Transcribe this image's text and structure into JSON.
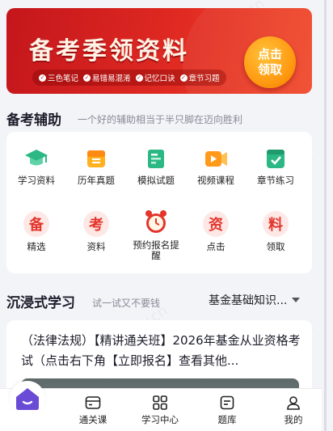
{
  "banner": {
    "title": "备考季领资料",
    "tags": [
      "三色笔记",
      "易错易混淆",
      "记忆口诀",
      "章节习题"
    ],
    "claim_button": "点击领取",
    "colors": {
      "bg": "#d81e1e",
      "button": "#ff9b12"
    }
  },
  "section_support": {
    "title": "备考辅助",
    "subtitle": "一个好的辅助相当于半只脚在迈向胜利"
  },
  "grid": [
    {
      "label": "学习资料",
      "icon": "graduation-cap-icon"
    },
    {
      "label": "历年真题",
      "icon": "gift-box-icon"
    },
    {
      "label": "模拟试题",
      "icon": "test-paper-icon"
    },
    {
      "label": "视频课程",
      "icon": "video-play-icon"
    },
    {
      "label": "章节练习",
      "icon": "checklist-icon"
    },
    {
      "label": "精选",
      "icon": "char-bei-icon",
      "char": "备"
    },
    {
      "label": "资料",
      "icon": "char-kao-icon",
      "char": "考"
    },
    {
      "label": "预约报名提醒",
      "icon": "alarm-clock-icon"
    },
    {
      "label": "点击",
      "icon": "char-zi-icon",
      "char": "资"
    },
    {
      "label": "领取",
      "icon": "char-liao-icon",
      "char": "料"
    }
  ],
  "section_immersive": {
    "title": "沉浸式学习",
    "subtitle": "试一试又不要钱",
    "dropdown_value": "基金基础知识..."
  },
  "course": {
    "text": "（法律法规）【精讲通关班】2026年基金从业资格考试（点击右下角【立即报名】查看其他..."
  },
  "bottom_nav": [
    {
      "label": "",
      "icon": "home-icon"
    },
    {
      "label": "通关课",
      "icon": "card-icon"
    },
    {
      "label": "学习中心",
      "icon": "grid-icon"
    },
    {
      "label": "题库",
      "icon": "document-icon"
    },
    {
      "label": "我的",
      "icon": "user-icon"
    }
  ],
  "watermark": "希赛 www.educity.cn"
}
